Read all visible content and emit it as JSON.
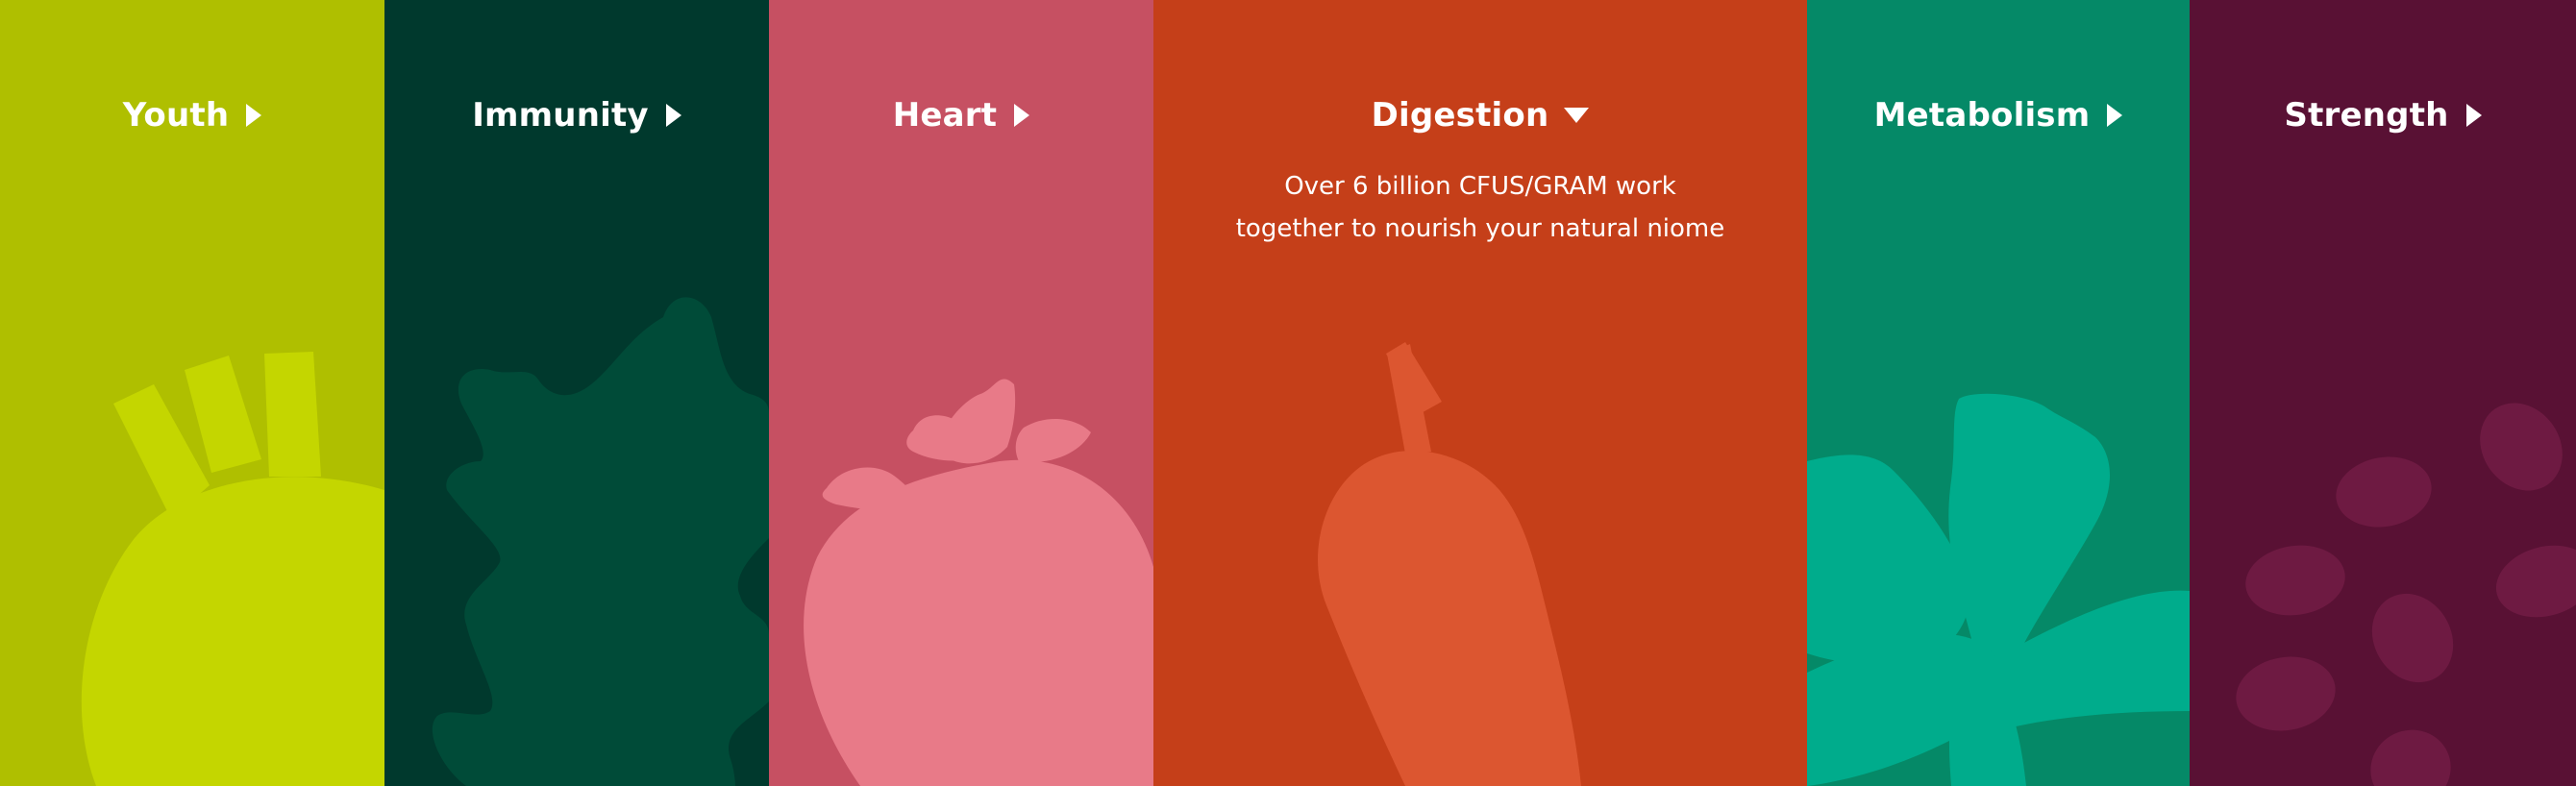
{
  "panels": [
    {
      "id": "youth",
      "label": "Youth",
      "indicator": "triangle-right-icon",
      "expanded": false,
      "color": "#afbf00",
      "illustration": "fennel-bulb-icon"
    },
    {
      "id": "immunity",
      "label": "Immunity",
      "indicator": "triangle-right-icon",
      "expanded": false,
      "color": "#00392d",
      "illustration": "kale-leaf-icon"
    },
    {
      "id": "heart",
      "label": "Heart",
      "indicator": "triangle-right-icon",
      "expanded": false,
      "color": "#c65062",
      "illustration": "strawberry-icon"
    },
    {
      "id": "digestion",
      "label": "Digestion",
      "indicator": "triangle-down-icon",
      "expanded": true,
      "color": "#c53f19",
      "illustration": "carrot-icon",
      "description_lines": [
        "Over 6 billion CFUS/GRAM work",
        "together to nourish your natural niome"
      ]
    },
    {
      "id": "metabolism",
      "label": "Metabolism",
      "indicator": "triangle-right-icon",
      "expanded": false,
      "color": "#058967",
      "illustration": "bok-choy-icon"
    },
    {
      "id": "strength",
      "label": "Strength",
      "indicator": "triangle-right-icon",
      "expanded": false,
      "color": "#591134",
      "illustration": "beans-icon"
    }
  ]
}
